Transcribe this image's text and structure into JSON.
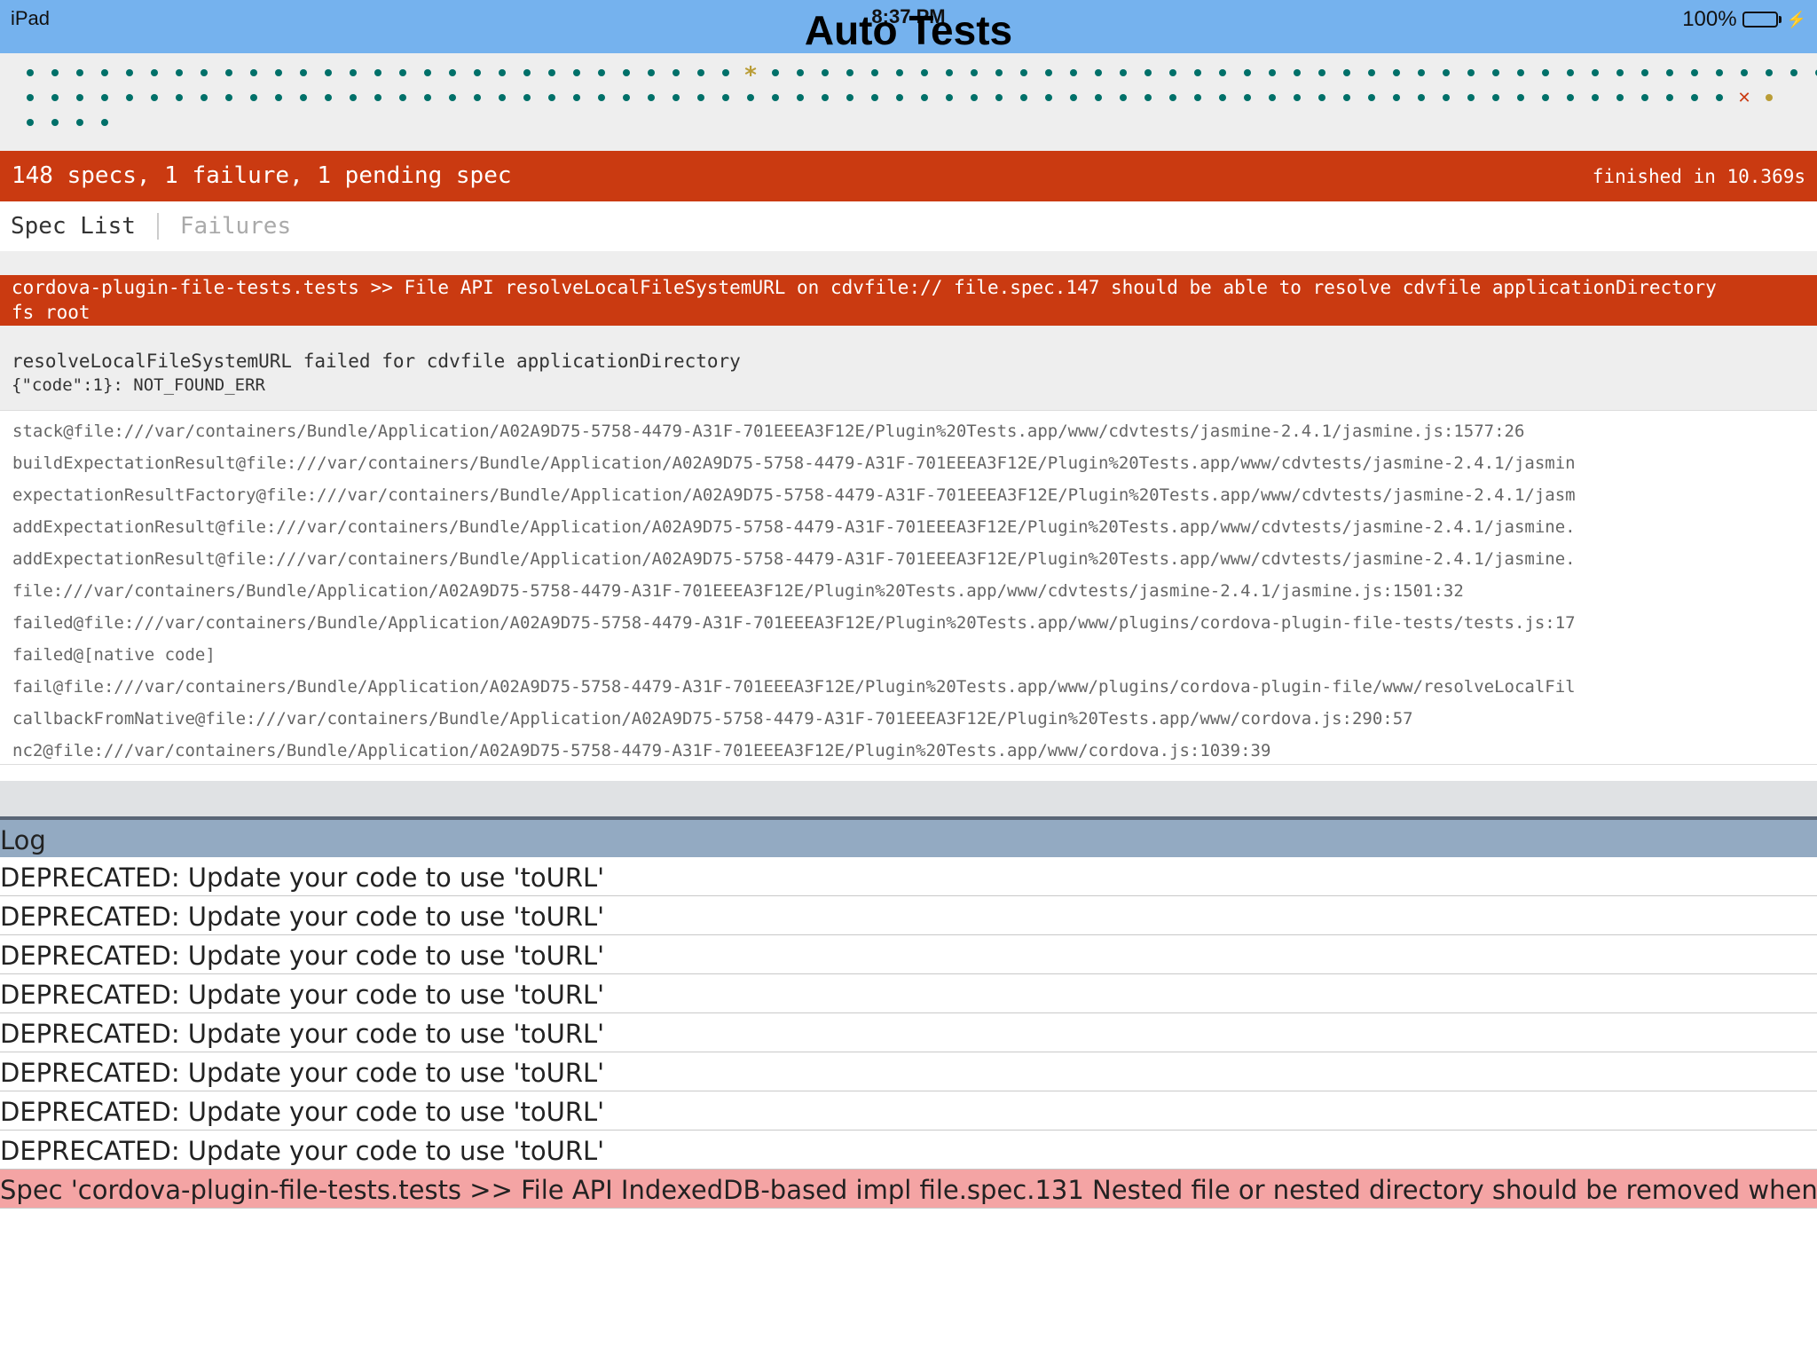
{
  "status_bar": {
    "device": "iPad",
    "time": "8:37 PM",
    "title": "Auto Tests",
    "battery": "100%",
    "battery_level": 1.0
  },
  "dots": {
    "row1": [
      "pass",
      "pass",
      "pass",
      "pass",
      "pass",
      "pass",
      "pass",
      "pass",
      "pass",
      "pass",
      "pass",
      "pass",
      "pass",
      "pass",
      "pass",
      "pass",
      "pass",
      "pass",
      "pass",
      "pass",
      "pass",
      "pass",
      "pass",
      "pass",
      "pass",
      "pass",
      "pass",
      "pass",
      "pass",
      "pend",
      "pass",
      "pass",
      "pass",
      "pass",
      "pass",
      "pass",
      "pass",
      "pass",
      "pass",
      "pass",
      "pass",
      "pass",
      "pass",
      "pass",
      "pass",
      "pass",
      "pass",
      "pass",
      "pass",
      "pass",
      "pass",
      "pass",
      "pass",
      "pass",
      "pass",
      "pass",
      "pass",
      "pass",
      "pass",
      "pass",
      "pass",
      "pass",
      "pass",
      "pass",
      "pass",
      "pass",
      "pass",
      "pass",
      "pass",
      "pass",
      "pass",
      "pass",
      "pass"
    ],
    "row2": [
      "pass",
      "pass",
      "pass",
      "pass",
      "pass",
      "pass",
      "pass",
      "pass",
      "pass",
      "pass",
      "pass",
      "pass",
      "pass",
      "pass",
      "pass",
      "pass",
      "pass",
      "pass",
      "pass",
      "pass",
      "pass",
      "pass",
      "pass",
      "pass",
      "pass",
      "pass",
      "pass",
      "pass",
      "pass",
      "pass",
      "pass",
      "pass",
      "pass",
      "pass",
      "pass",
      "pass",
      "pass",
      "pass",
      "pass",
      "pass",
      "pass",
      "pass",
      "pass",
      "pass",
      "pass",
      "pass",
      "pass",
      "pass",
      "pass",
      "pass",
      "pass",
      "pass",
      "pass",
      "pass",
      "pass",
      "pass",
      "pass",
      "pass",
      "pass",
      "pass",
      "pass",
      "pass",
      "pass",
      "pass",
      "pass",
      "pass",
      "pass",
      "pass",
      "pass",
      "fail",
      "empty"
    ],
    "row3": [
      "pass",
      "pass",
      "pass",
      "pass"
    ],
    "colors": {
      "pass": "#007069",
      "pending": "#ba9d37",
      "fail": "#ca3a11"
    }
  },
  "summary": {
    "overall": "148 specs, 1 failure, 1 pending spec",
    "duration": "finished in 10.369s",
    "color": "#ca3a11"
  },
  "menu": {
    "spec_list": "Spec List",
    "failures": "Failures"
  },
  "failure": {
    "description_line1": "cordova-plugin-file-tests.tests >> File API resolveLocalFileSystemURL on cdvfile:// file.spec.147 should be able to resolve cdvfile applicationDirectory",
    "description_line2": "fs root",
    "message_line1": "resolveLocalFileSystemURL failed for cdvfile applicationDirectory",
    "message_line2": "{\"code\":1}: NOT_FOUND_ERR",
    "stack": [
      "stack@file:///var/containers/Bundle/Application/A02A9D75-5758-4479-A31F-701EEEA3F12E/Plugin%20Tests.app/www/cdvtests/jasmine-2.4.1/jasmine.js:1577:26",
      "buildExpectationResult@file:///var/containers/Bundle/Application/A02A9D75-5758-4479-A31F-701EEEA3F12E/Plugin%20Tests.app/www/cdvtests/jasmine-2.4.1/jasmin",
      "expectationResultFactory@file:///var/containers/Bundle/Application/A02A9D75-5758-4479-A31F-701EEEA3F12E/Plugin%20Tests.app/www/cdvtests/jasmine-2.4.1/jasm",
      "addExpectationResult@file:///var/containers/Bundle/Application/A02A9D75-5758-4479-A31F-701EEEA3F12E/Plugin%20Tests.app/www/cdvtests/jasmine-2.4.1/jasmine.",
      "addExpectationResult@file:///var/containers/Bundle/Application/A02A9D75-5758-4479-A31F-701EEEA3F12E/Plugin%20Tests.app/www/cdvtests/jasmine-2.4.1/jasmine.",
      "file:///var/containers/Bundle/Application/A02A9D75-5758-4479-A31F-701EEEA3F12E/Plugin%20Tests.app/www/cdvtests/jasmine-2.4.1/jasmine.js:1501:32",
      "failed@file:///var/containers/Bundle/Application/A02A9D75-5758-4479-A31F-701EEEA3F12E/Plugin%20Tests.app/www/plugins/cordova-plugin-file-tests/tests.js:17",
      "failed@[native code]",
      "fail@file:///var/containers/Bundle/Application/A02A9D75-5758-4479-A31F-701EEEA3F12E/Plugin%20Tests.app/www/plugins/cordova-plugin-file/www/resolveLocalFil",
      "callbackFromNative@file:///var/containers/Bundle/Application/A02A9D75-5758-4479-A31F-701EEEA3F12E/Plugin%20Tests.app/www/cordova.js:290:57",
      "nc2@file:///var/containers/Bundle/Application/A02A9D75-5758-4479-A31F-701EEEA3F12E/Plugin%20Tests.app/www/cordova.js:1039:39"
    ]
  },
  "log": {
    "header": "Log",
    "entries": [
      {
        "text": "DEPRECATED: Update your code to use 'toURL'",
        "type": "normal"
      },
      {
        "text": "DEPRECATED: Update your code to use 'toURL'",
        "type": "normal"
      },
      {
        "text": "DEPRECATED: Update your code to use 'toURL'",
        "type": "normal"
      },
      {
        "text": "DEPRECATED: Update your code to use 'toURL'",
        "type": "normal"
      },
      {
        "text": "DEPRECATED: Update your code to use 'toURL'",
        "type": "normal"
      },
      {
        "text": "DEPRECATED: Update your code to use 'toURL'",
        "type": "normal"
      },
      {
        "text": "DEPRECATED: Update your code to use 'toURL'",
        "type": "normal"
      },
      {
        "text": "DEPRECATED: Update your code to use 'toURL'",
        "type": "normal"
      },
      {
        "text": "Spec 'cordova-plugin-file-tests.tests >> File API IndexedDB-based impl file.spec.131 Nested file or nested directory should be removed when removing a parent d",
        "type": "error"
      }
    ]
  }
}
